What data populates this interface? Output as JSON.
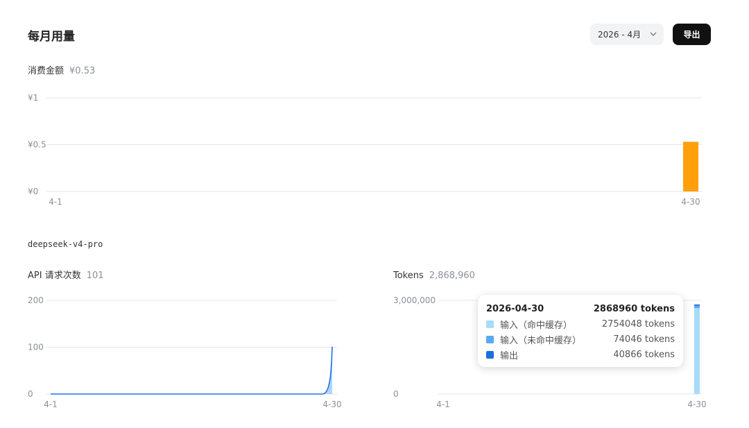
{
  "header": {
    "title": "每月用量",
    "month_select": "2026 - 4月",
    "export_label": "导出"
  },
  "cost": {
    "label": "消费金额",
    "value": "¥0.53"
  },
  "model": "deepseek-v4-pro",
  "requests": {
    "label": "API 请求次数",
    "value": "101"
  },
  "tokens": {
    "label": "Tokens",
    "value": "2,868,960"
  },
  "tooltip": {
    "date": "2026-04-30",
    "total": "2868960 tokens",
    "rows": [
      {
        "label": "输入（命中缓存）",
        "value": "2754048 tokens",
        "color": "#a6dcf7"
      },
      {
        "label": "输入（未命中缓存）",
        "value": "74046 tokens",
        "color": "#59a9ee"
      },
      {
        "label": "输出",
        "value": "40866 tokens",
        "color": "#1b6fdc"
      }
    ]
  },
  "colors": {
    "cost_bar": "#ff9f0a",
    "requests_line": "#1a73e8",
    "requests_area": "#9ccaf5",
    "gridline": "#e3e6ef",
    "tick_text": "#8a8f99"
  },
  "chart_data": [
    {
      "type": "bar",
      "ylabel_ticks": [
        "¥0",
        "¥0.5",
        "¥1"
      ],
      "ylim": [
        0,
        1
      ],
      "x_ticks": [
        "4-1",
        "4-30"
      ],
      "days": 30,
      "values": [
        0,
        0,
        0,
        0,
        0,
        0,
        0,
        0,
        0,
        0,
        0,
        0,
        0,
        0,
        0,
        0,
        0,
        0,
        0,
        0,
        0,
        0,
        0,
        0,
        0,
        0,
        0,
        0,
        0,
        0.53
      ],
      "grid": true
    },
    {
      "type": "area",
      "ylabel_ticks": [
        "0",
        "100",
        "200"
      ],
      "ylim": [
        0,
        200
      ],
      "x_ticks": [
        "4-1",
        "4-30"
      ],
      "days": 30,
      "values": [
        0,
        0,
        0,
        0,
        0,
        0,
        0,
        0,
        0,
        0,
        0,
        0,
        0,
        0,
        0,
        0,
        0,
        0,
        0,
        0,
        0,
        0,
        0,
        0,
        0,
        0,
        0,
        0,
        0,
        101
      ],
      "grid": true
    },
    {
      "type": "bar",
      "stacked": true,
      "ylabel_ticks": [
        "0",
        "3,000,000"
      ],
      "ylim": [
        0,
        3000000
      ],
      "x_ticks": [
        "4-1",
        "4-30"
      ],
      "days": 30,
      "series": [
        {
          "name": "输入（命中缓存）",
          "values": [
            0,
            0,
            0,
            0,
            0,
            0,
            0,
            0,
            0,
            0,
            0,
            0,
            0,
            0,
            0,
            0,
            0,
            0,
            0,
            0,
            0,
            0,
            0,
            0,
            0,
            0,
            0,
            0,
            0,
            2754048
          ]
        },
        {
          "name": "输入（未命中缓存）",
          "values": [
            0,
            0,
            0,
            0,
            0,
            0,
            0,
            0,
            0,
            0,
            0,
            0,
            0,
            0,
            0,
            0,
            0,
            0,
            0,
            0,
            0,
            0,
            0,
            0,
            0,
            0,
            0,
            0,
            0,
            74046
          ]
        },
        {
          "name": "输出",
          "values": [
            0,
            0,
            0,
            0,
            0,
            0,
            0,
            0,
            0,
            0,
            0,
            0,
            0,
            0,
            0,
            0,
            0,
            0,
            0,
            0,
            0,
            0,
            0,
            0,
            0,
            0,
            0,
            0,
            0,
            40866
          ]
        }
      ],
      "grid": true
    }
  ]
}
